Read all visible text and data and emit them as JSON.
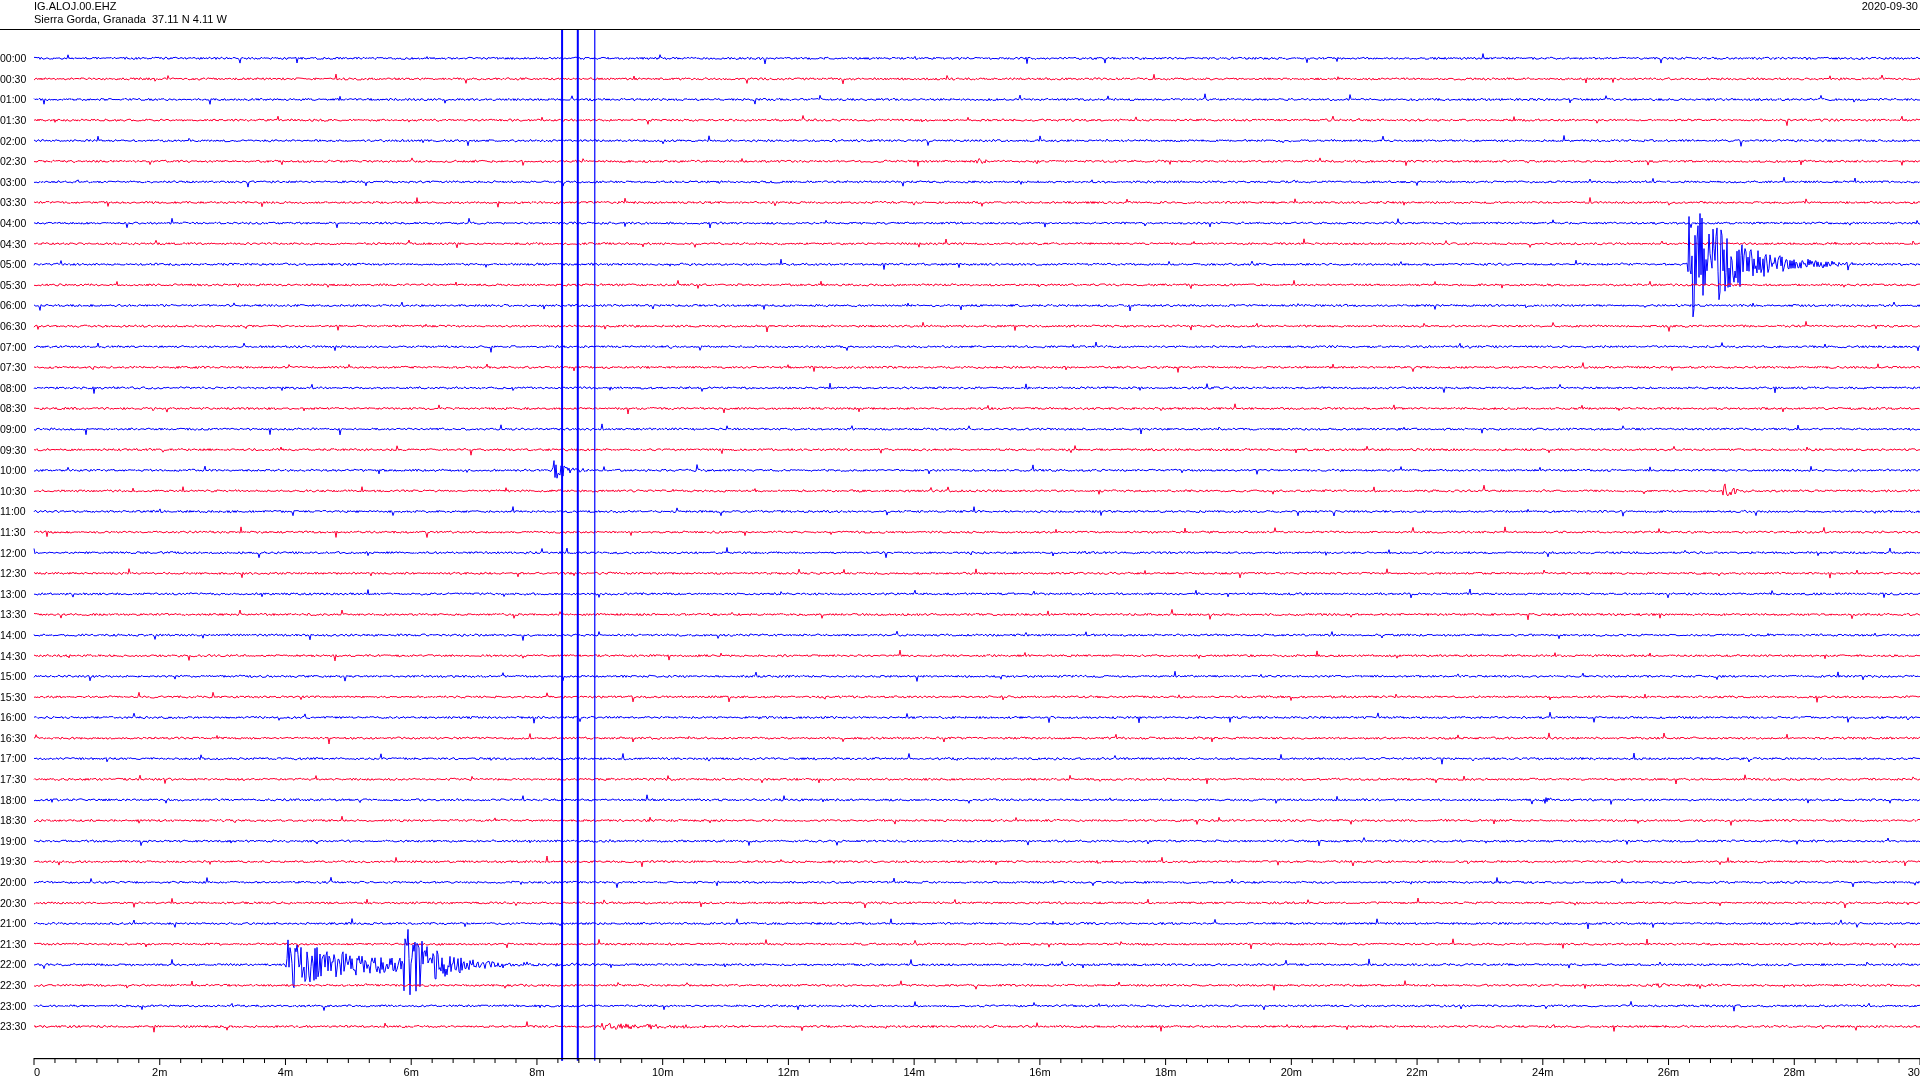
{
  "header": {
    "station": "IG.ALOJ.00.EHZ",
    "location": "Sierra Gorda, Granada  37.11 N 4.11 W",
    "date": "2020-09-30"
  },
  "rows": [
    {
      "label": "00:00",
      "color": "#0000ff"
    },
    {
      "label": "00:30",
      "color": "#ff0033"
    },
    {
      "label": "01:00",
      "color": "#0000ff"
    },
    {
      "label": "01:30",
      "color": "#ff0033"
    },
    {
      "label": "02:00",
      "color": "#0000ff"
    },
    {
      "label": "02:30",
      "color": "#ff0033"
    },
    {
      "label": "03:00",
      "color": "#0000ff"
    },
    {
      "label": "03:30",
      "color": "#ff0033"
    },
    {
      "label": "04:00",
      "color": "#0000ff"
    },
    {
      "label": "04:30",
      "color": "#ff0033"
    },
    {
      "label": "05:00",
      "color": "#0000ff"
    },
    {
      "label": "05:30",
      "color": "#ff0033"
    },
    {
      "label": "06:00",
      "color": "#0000ff"
    },
    {
      "label": "06:30",
      "color": "#ff0033"
    },
    {
      "label": "07:00",
      "color": "#0000ff"
    },
    {
      "label": "07:30",
      "color": "#ff0033"
    },
    {
      "label": "08:00",
      "color": "#0000ff"
    },
    {
      "label": "08:30",
      "color": "#ff0033"
    },
    {
      "label": "09:00",
      "color": "#0000ff"
    },
    {
      "label": "09:30",
      "color": "#ff0033"
    },
    {
      "label": "10:00",
      "color": "#0000ff"
    },
    {
      "label": "10:30",
      "color": "#ff0033"
    },
    {
      "label": "11:00",
      "color": "#0000ff"
    },
    {
      "label": "11:30",
      "color": "#ff0033"
    },
    {
      "label": "12:00",
      "color": "#0000ff"
    },
    {
      "label": "12:30",
      "color": "#ff0033"
    },
    {
      "label": "13:00",
      "color": "#0000ff"
    },
    {
      "label": "13:30",
      "color": "#ff0033"
    },
    {
      "label": "14:00",
      "color": "#0000ff"
    },
    {
      "label": "14:30",
      "color": "#ff0033"
    },
    {
      "label": "15:00",
      "color": "#0000ff"
    },
    {
      "label": "15:30",
      "color": "#ff0033"
    },
    {
      "label": "16:00",
      "color": "#0000ff"
    },
    {
      "label": "16:30",
      "color": "#ff0033"
    },
    {
      "label": "17:00",
      "color": "#0000ff"
    },
    {
      "label": "17:30",
      "color": "#ff0033"
    },
    {
      "label": "18:00",
      "color": "#0000ff"
    },
    {
      "label": "18:30",
      "color": "#ff0033"
    },
    {
      "label": "19:00",
      "color": "#0000ff"
    },
    {
      "label": "19:30",
      "color": "#ff0033"
    },
    {
      "label": "20:00",
      "color": "#0000ff"
    },
    {
      "label": "20:30",
      "color": "#ff0033"
    },
    {
      "label": "21:00",
      "color": "#0000ff"
    },
    {
      "label": "21:30",
      "color": "#ff0033"
    },
    {
      "label": "22:00",
      "color": "#0000ff"
    },
    {
      "label": "22:30",
      "color": "#ff0033"
    },
    {
      "label": "23:00",
      "color": "#0000ff"
    },
    {
      "label": "23:30",
      "color": "#ff0033"
    }
  ],
  "x_axis": {
    "ticks": [
      "0",
      "2m",
      "4m",
      "6m",
      "8m",
      "10m",
      "12m",
      "14m",
      "16m",
      "18m",
      "20m",
      "22m",
      "24m",
      "26m",
      "28m",
      "30"
    ]
  }
}
